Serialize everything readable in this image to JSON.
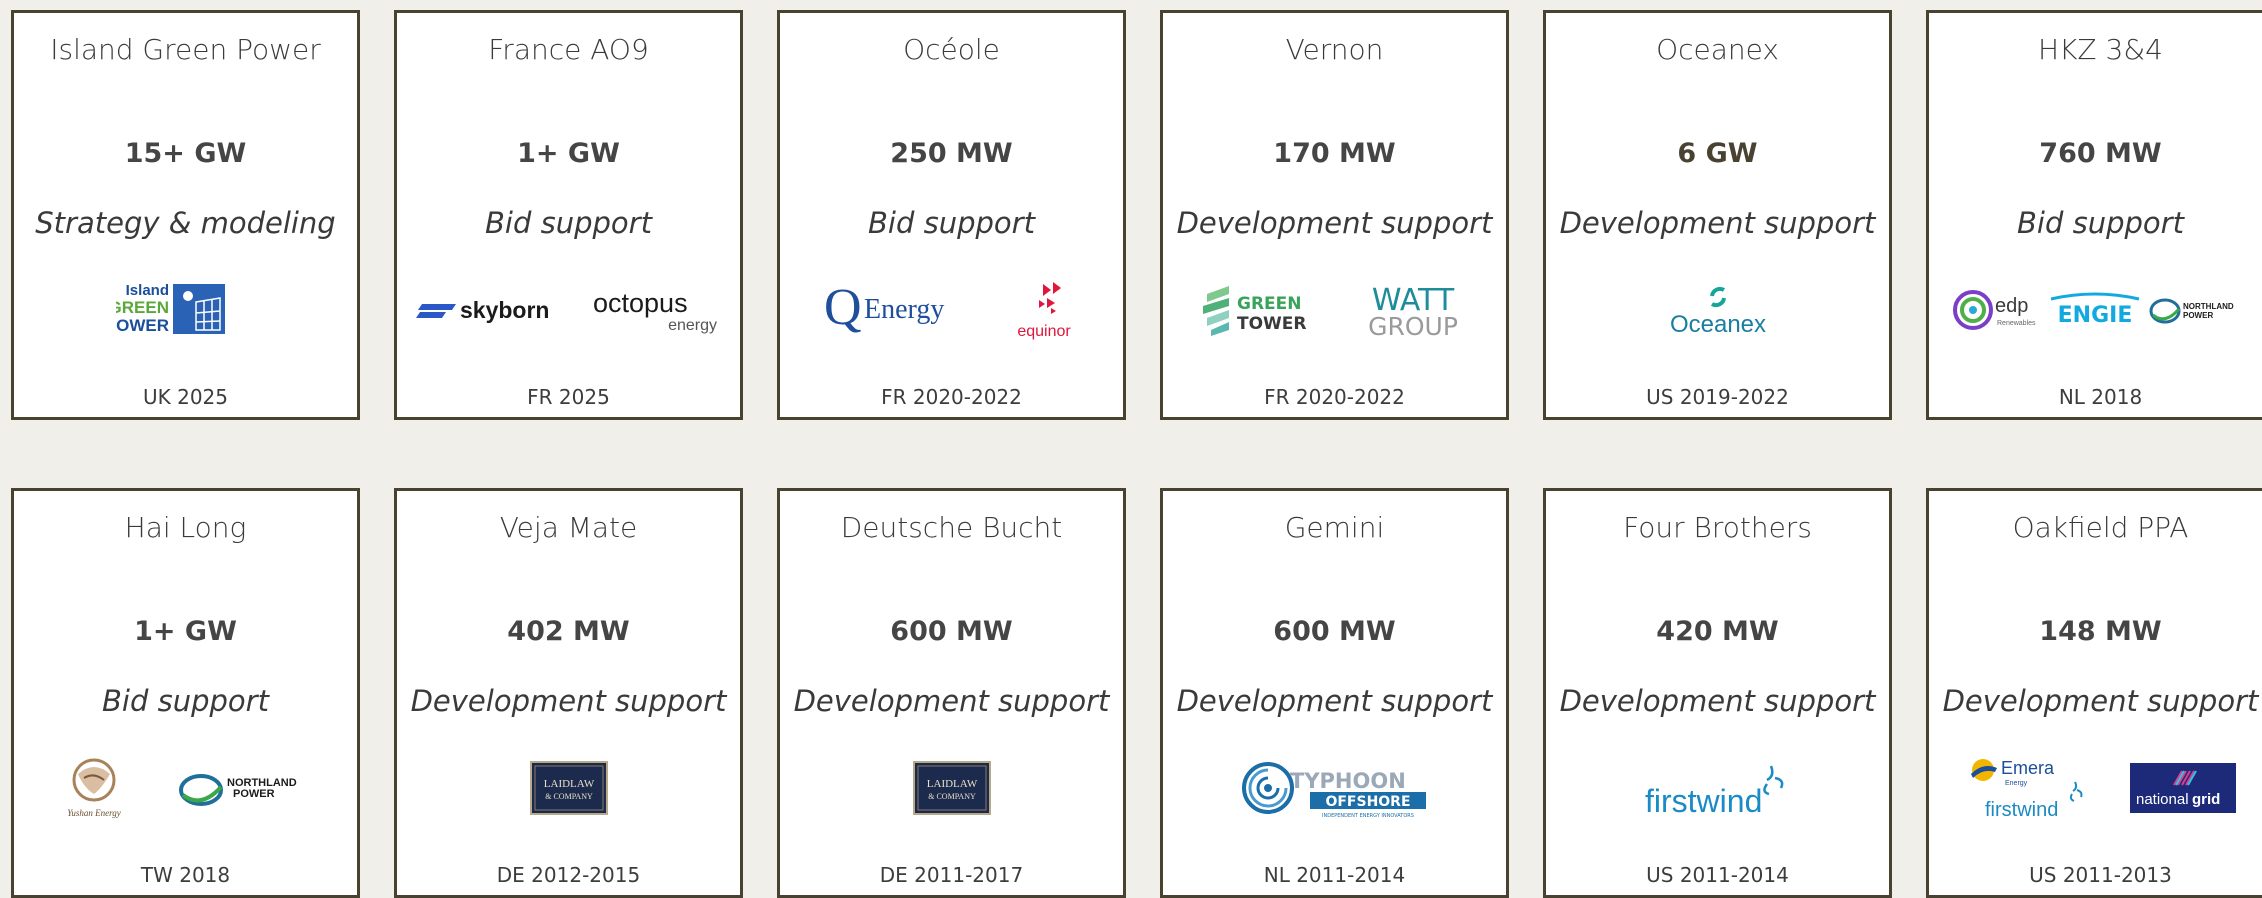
{
  "projects": [
    {
      "name": "Island Green Power",
      "capacity": "15+ GW",
      "service": "Strategy & modeling",
      "location": "UK 2025",
      "logos": [
        {
          "icon": "island-green-power-logo",
          "lines": [
            "Island",
            "GREEN",
            "POWER"
          ]
        }
      ]
    },
    {
      "name": "France AO9",
      "capacity": "1+ GW",
      "service": "Bid support",
      "location": "FR 2025",
      "logos": [
        {
          "icon": "skyborn-logo",
          "text": "skyborn"
        },
        {
          "icon": "octopus-energy-logo",
          "text": "octopus",
          "sub": "energy"
        }
      ]
    },
    {
      "name": "Océole",
      "capacity": "250 MW",
      "service": "Bid support",
      "location": "FR 2020-2022",
      "logos": [
        {
          "icon": "qenergy-logo",
          "text": "Energy"
        },
        {
          "icon": "equinor-logo",
          "text": "equinor"
        }
      ]
    },
    {
      "name": "Vernon",
      "capacity": "170 MW",
      "service": "Development support",
      "location": "FR 2020-2022",
      "logos": [
        {
          "icon": "green-tower-logo",
          "lines": [
            "GREEN",
            "TOWER"
          ]
        },
        {
          "icon": "watt-group-logo",
          "lines": [
            "WATT",
            "GROUP"
          ]
        }
      ]
    },
    {
      "name": "Oceanex",
      "capacity": "6 GW",
      "service": "Development support",
      "location": "US 2019-2022",
      "logos": [
        {
          "icon": "oceanex-logo",
          "text": "Oceanex"
        }
      ]
    },
    {
      "name": "HKZ 3&4",
      "capacity": "760 MW",
      "service": "Bid support",
      "location": "NL 2018",
      "logos": [
        {
          "icon": "edp-logo",
          "text": "edp",
          "sub": "Renewables"
        },
        {
          "icon": "engie-logo",
          "text": "ENGIE"
        },
        {
          "icon": "northland-power-logo",
          "lines": [
            "NORTHLAND",
            "POWER"
          ]
        }
      ]
    },
    {
      "name": "Hai Long",
      "capacity": "1+ GW",
      "service": "Bid support",
      "location": "TW 2018",
      "logos": [
        {
          "icon": "yushan-energy-logo",
          "text": "Yushan Energy"
        },
        {
          "icon": "northland-power-logo",
          "lines": [
            "NORTHLAND",
            "POWER"
          ]
        }
      ]
    },
    {
      "name": "Veja Mate",
      "capacity": "402 MW",
      "service": "Development support",
      "location": "DE 2012-2015",
      "logos": [
        {
          "icon": "laidlaw-logo",
          "lines": [
            "LAIDLAW",
            "& COMPANY"
          ]
        }
      ]
    },
    {
      "name": "Deutsche Bucht",
      "capacity": "600 MW",
      "service": "Development support",
      "location": "DE 2011-2017",
      "logos": [
        {
          "icon": "laidlaw-logo",
          "lines": [
            "LAIDLAW",
            "& COMPANY"
          ]
        }
      ]
    },
    {
      "name": "Gemini",
      "capacity": "600 MW",
      "service": "Development support",
      "location": "NL 2011-2014",
      "logos": [
        {
          "icon": "typhoon-offshore-logo",
          "lines": [
            "TYPHOON",
            "OFFSHORE",
            "INDEPENDENT ENERGY INNOVATORS"
          ]
        }
      ]
    },
    {
      "name": "Four Brothers",
      "capacity": "420 MW",
      "service": "Development support",
      "location": "US 2011-2014",
      "logos": [
        {
          "icon": "firstwind-logo",
          "text": "firstwind"
        }
      ]
    },
    {
      "name": "Oakfield PPA",
      "capacity": "148 MW",
      "service": "Development support",
      "location": "US 2011-2013",
      "logos": [
        {
          "icon": "emera-firstwind-logo",
          "lines": [
            "Emera",
            "Energy",
            "firstwind"
          ]
        },
        {
          "icon": "national-grid-logo",
          "lines": [
            "national",
            "grid"
          ]
        }
      ]
    }
  ],
  "colors": {
    "background": "#f0efea",
    "border": "#4a4230",
    "text": "#3a3a3a",
    "green": "#5aa83a",
    "blue": "#1b4e9b"
  }
}
